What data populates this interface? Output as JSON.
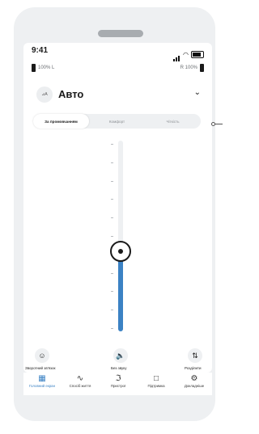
{
  "status_bar": {
    "time": "9:41"
  },
  "batteries": {
    "left_label": "100% L",
    "right_label": "R 100%"
  },
  "program": {
    "name": "Авто",
    "icon_text": "⊿A",
    "chevron": "⌄"
  },
  "modes": [
    {
      "label": "За промовчанням",
      "active": true
    },
    {
      "label": "Комфорт",
      "active": false
    },
    {
      "label": "Чіткість",
      "active": false
    }
  ],
  "volume": {
    "level": 0.42
  },
  "quick_actions": {
    "left": {
      "label": "Зворотний зв'язок",
      "icon": "smile-icon",
      "glyph": "☺"
    },
    "center": {
      "label": "Без звуку",
      "icon": "speaker-icon",
      "glyph": "🔈"
    },
    "right": {
      "label": "Розділити",
      "icon": "split-icon",
      "glyph": "⇅"
    }
  },
  "tabs": [
    {
      "label": "Головний екран",
      "icon": "grid-icon",
      "glyph": "▦",
      "active": true
    },
    {
      "label": "Спосіб життя",
      "icon": "activity-icon",
      "glyph": "∿",
      "active": false
    },
    {
      "label": "Пристрої",
      "icon": "devices-icon",
      "glyph": "ℑ",
      "active": false
    },
    {
      "label": "Підтримка",
      "icon": "chat-icon",
      "glyph": "□",
      "active": false
    },
    {
      "label": "Докладніше",
      "icon": "gear-icon",
      "glyph": "⚙",
      "active": false
    }
  ],
  "colors": {
    "accent": "#3b82c4",
    "track": "#eef0f2",
    "device": "#eef0f2"
  }
}
